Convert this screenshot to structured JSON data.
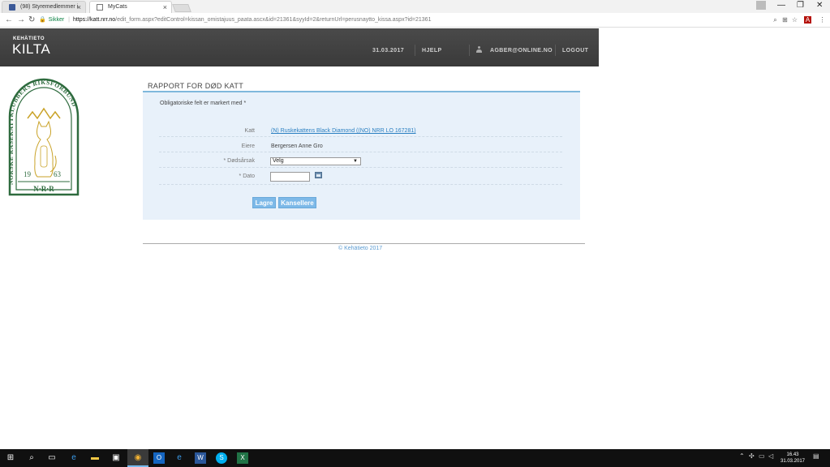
{
  "browser": {
    "tabs": [
      {
        "label": "(98) Styremedlemmer i ",
        "icon": "facebook-icon"
      },
      {
        "label": "MyCats",
        "icon": "document-icon"
      }
    ],
    "url": {
      "secure_label": "Sikker",
      "host": "https://katt.nrr.no",
      "path": "/edit_form.aspx?editControl=kissan_omistajuus_paata.ascx&id=21361&syyId=2&returnUrl=perusnaytto_kissa.aspx?id=21361"
    }
  },
  "header": {
    "logo_small": "KEHÄTIETO",
    "logo_big": "KILTA",
    "date": "31.03.2017",
    "help": "HJELP",
    "user": "AGBER@ONLINE.NO",
    "logout": "LOGOUT"
  },
  "emblem": {
    "ring_text": "NORSKE RASEKATTKLUBBERS RIKSFORBUND",
    "year_left": "19",
    "year_right": "63",
    "bottom": "N·R·R"
  },
  "form": {
    "title": "RAPPORT FOR DØD KATT",
    "required_note": "Obligatoriske felt er markert med *",
    "cat_label": "Katt",
    "cat_value": "(N) Ruskekattens Black Diamond ((NO) NRR LO 167281)",
    "owners_label": "Eiere",
    "owners_value": "Bergersen Anne Gro",
    "cause_label": "* Dødsårsak",
    "cause_selected": "Velg",
    "date_label": "* Dato",
    "date_value": "",
    "save_button": "Lagre",
    "cancel_button": "Kansellere"
  },
  "footer": {
    "text": "© Kehätieto 2017"
  },
  "taskbar": {
    "time": "16.43",
    "date": "31.03.2017"
  },
  "colors": {
    "header_bg": "#404040",
    "panel_bg": "#e8f1fa",
    "accent_blue": "#7db9e8",
    "link_blue": "#2a7fc1",
    "emblem_green": "#2e6b3e"
  }
}
